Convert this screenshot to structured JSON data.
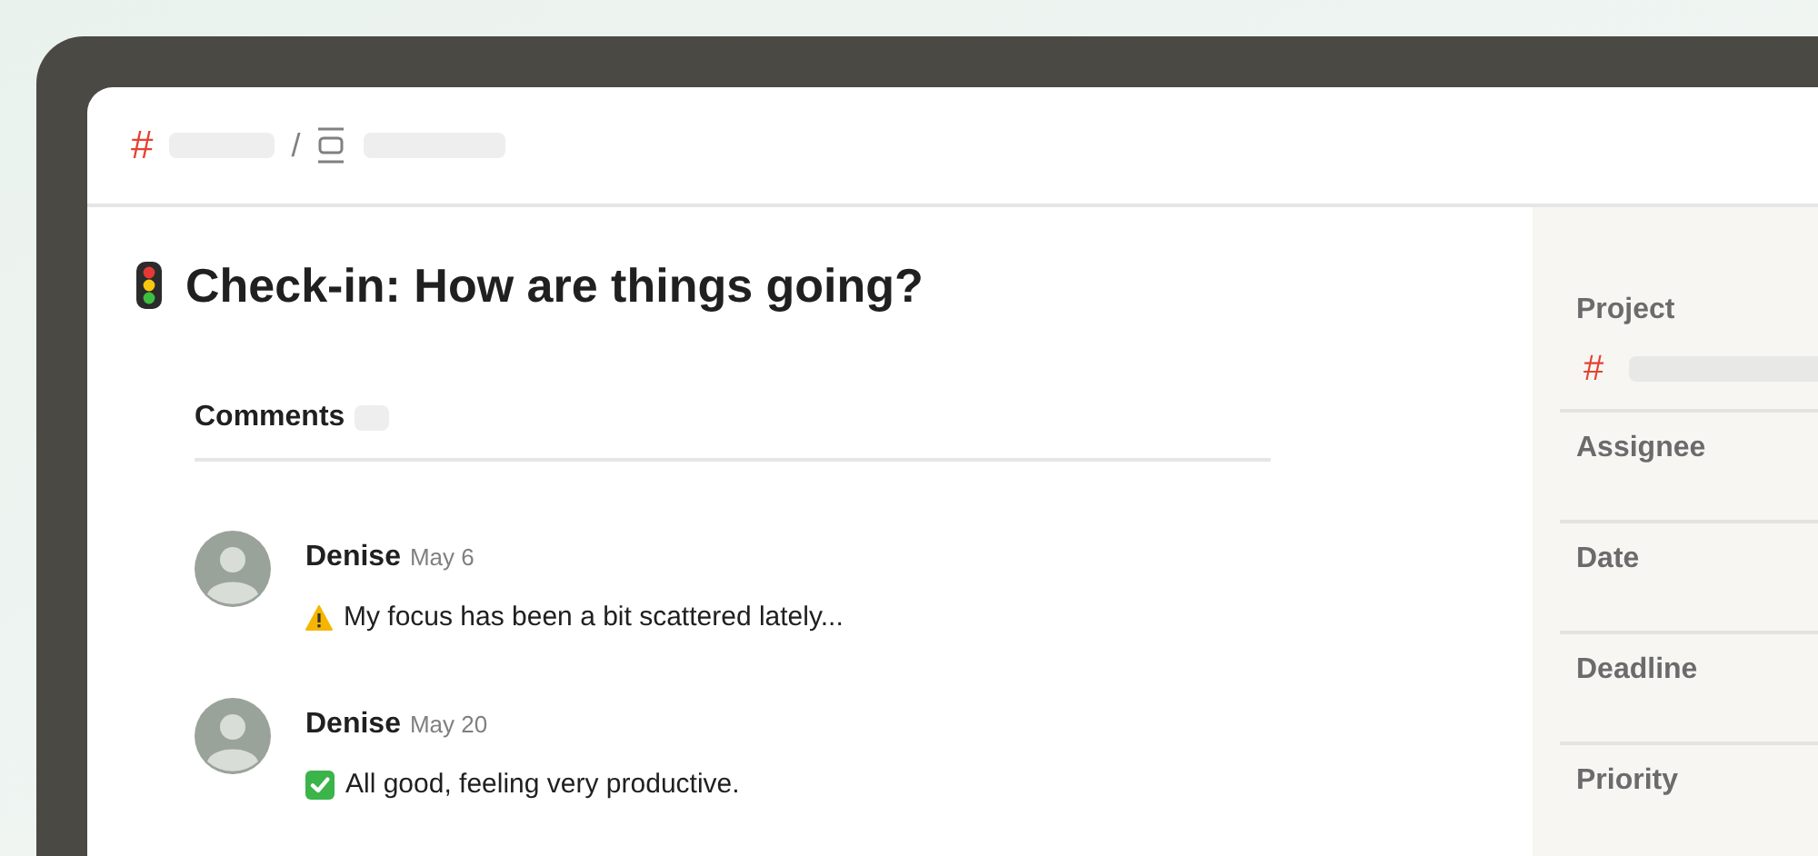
{
  "breadcrumb": {
    "project_icon": "#",
    "separator": "/"
  },
  "task": {
    "title": "Check-in: How are things going?"
  },
  "comments": {
    "heading": "Comments",
    "items": [
      {
        "author": "Denise",
        "date": "May 6",
        "kind": "warning",
        "text": "My focus has been a bit scattered lately..."
      },
      {
        "author": "Denise",
        "date": "May 20",
        "kind": "done",
        "text": "All good, feeling very productive."
      }
    ]
  },
  "sidebar": {
    "fields": [
      {
        "label": "Project",
        "kind": "project",
        "icon": "#"
      },
      {
        "label": "Assignee",
        "kind": "empty"
      },
      {
        "label": "Date",
        "kind": "empty"
      },
      {
        "label": "Deadline",
        "kind": "empty"
      },
      {
        "label": "Priority",
        "kind": "empty"
      }
    ]
  }
}
